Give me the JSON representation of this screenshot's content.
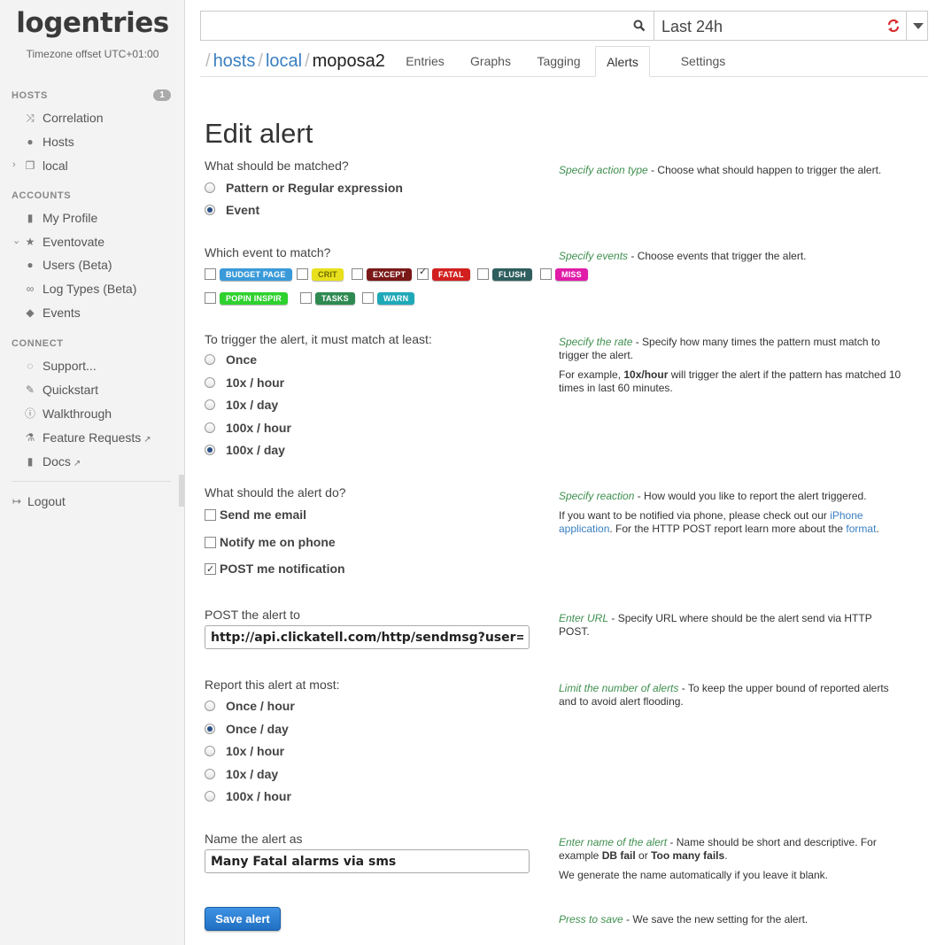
{
  "sidebar": {
    "logo": "logentries",
    "timezone": "Timezone offset UTC+01:00",
    "hosts_header": "HOSTS",
    "hosts_badge": "1",
    "hosts_items": [
      {
        "label": "Correlation",
        "icon": "shuffle-icon"
      },
      {
        "label": "Hosts",
        "icon": "globe-icon"
      },
      {
        "label": "local",
        "icon": "copy-icon"
      }
    ],
    "accounts_header": "ACCOUNTS",
    "accounts_items": [
      {
        "label": "My Profile",
        "icon": "book-icon"
      },
      {
        "label": "Eventovate",
        "icon": "star-icon"
      },
      {
        "label": "Users (Beta)",
        "icon": "user-icon"
      },
      {
        "label": "Log Types (Beta)",
        "icon": "link-icon"
      },
      {
        "label": "Events",
        "icon": "tags-icon"
      }
    ],
    "connect_header": "CONNECT",
    "connect_items": [
      {
        "label": "Support...",
        "icon": "comment-icon"
      },
      {
        "label": "Quickstart",
        "icon": "wrench-icon"
      },
      {
        "label": "Walkthrough",
        "icon": "info-icon"
      },
      {
        "label": "Feature Requests",
        "icon": "beaker-icon"
      },
      {
        "label": "Docs",
        "icon": "book-icon"
      }
    ],
    "logout": "Logout"
  },
  "topbar": {
    "search_value": "",
    "time_range": "Last 24h"
  },
  "breadcrumb": {
    "hosts": "hosts",
    "local": "local",
    "current": "moposa2"
  },
  "tabs": [
    "Entries",
    "Graphs",
    "Tagging",
    "Alerts",
    "Settings"
  ],
  "active_tab": "Alerts",
  "form": {
    "title": "Edit alert",
    "match_q": "What should be matched?",
    "match_options": [
      "Pattern or Regular expression",
      "Event"
    ],
    "event_q": "Which event to match?",
    "events": [
      {
        "label": "BUDGET PAGE",
        "color": "#3a9ad9",
        "checked": false
      },
      {
        "label": "CRIT",
        "color": "#e8e01c",
        "checked": false
      },
      {
        "label": "EXCEPT",
        "color": "#7a1818",
        "checked": false
      },
      {
        "label": "FATAL",
        "color": "#d21f1f",
        "checked": true
      },
      {
        "label": "FLUSH",
        "color": "#2e5e5e",
        "checked": false
      },
      {
        "label": "MISS",
        "color": "#e01ca8",
        "checked": false
      },
      {
        "label": "POPIN INSPIR",
        "color": "#2fd12f",
        "checked": false
      },
      {
        "label": "TASKS",
        "color": "#2f8a52",
        "checked": false
      },
      {
        "label": "WARN",
        "color": "#1fa9b8",
        "checked": false
      }
    ],
    "rate_q": "To trigger the alert, it must match at least:",
    "rate_options": [
      "Once",
      "10x / hour",
      "10x / day",
      "100x / hour",
      "100x / day"
    ],
    "do_q": "What should the alert do?",
    "do_options": [
      "Send me email",
      "Notify me on phone",
      "POST me notification"
    ],
    "post_q": "POST the alert to",
    "post_url": "http://api.clickatell.com/http/sendmsg?user=event",
    "report_q": "Report this alert at most:",
    "report_options": [
      "Once / hour",
      "Once / day",
      "10x / hour",
      "10x / day",
      "100x / hour"
    ],
    "name_q": "Name the alert as",
    "name_value": "Many Fatal alarms via sms",
    "save_label": "Save alert"
  },
  "help": {
    "action_hint": "Specify action type",
    "action_text": " - Choose what should happen to trigger the alert.",
    "events_hint": "Specify events",
    "events_text": " - Choose events that trigger the alert.",
    "rate_hint": "Specify the rate",
    "rate_text": " - Specify how many times the pattern must match to trigger the alert.",
    "rate_ex1": "For example, ",
    "rate_ex_b": "10x/hour",
    "rate_ex2": " will trigger the alert if the pattern has matched 10 times in last 60 minutes.",
    "reaction_hint": "Specify reaction",
    "reaction_text": " - How would you like to report the alert triggered.",
    "reaction_p1": "If you want to be notified via phone, please check out our ",
    "reaction_link1": "iPhone application",
    "reaction_p2": ". For the HTTP POST report learn more about the ",
    "reaction_link2": "format",
    "reaction_p3": ".",
    "url_hint": "Enter URL",
    "url_text": " - Specify URL where should be the alert send via HTTP POST.",
    "limit_hint": "Limit the number of alerts",
    "limit_text": " - To keep the upper bound of reported alerts and to avoid alert flooding.",
    "name_hint": "Enter name of the alert",
    "name_text": " - Name should be short and descriptive. For example ",
    "name_b1": "DB fail",
    "name_or": " or ",
    "name_b2": "Too many fails",
    "name_dot": ".",
    "name_p2": "We generate the name automatically if you leave it blank.",
    "save_hint": "Press to save",
    "save_text": " - We save the new setting for the alert."
  }
}
